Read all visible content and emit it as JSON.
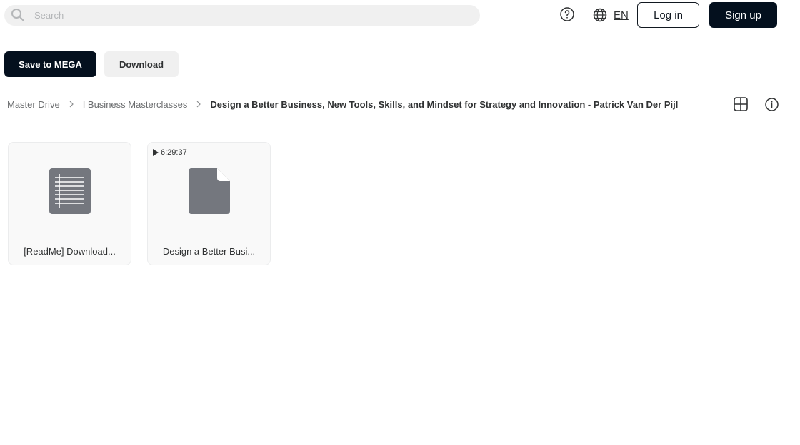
{
  "search": {
    "placeholder": "Search",
    "value": ""
  },
  "header": {
    "language_code": "EN",
    "login_label": "Log in",
    "signup_label": "Sign up"
  },
  "actions": {
    "save_label": "Save to MEGA",
    "download_label": "Download"
  },
  "breadcrumb": {
    "items": [
      "Master Drive",
      "I Business Masterclasses"
    ],
    "current": "Design a Better Business, New Tools, Skills, and Mindset for Strategy and Innovation - Patrick Van Der Pijl"
  },
  "files": [
    {
      "name": "[ReadMe] Download...",
      "type": "text",
      "icon": "text-file-icon"
    },
    {
      "name": "Design a Better Busi...",
      "type": "video",
      "icon": "generic-file-icon",
      "duration": "6:29:37"
    }
  ],
  "colors": {
    "primary_dark": "#04101e",
    "file_icon_gray": "#74777e",
    "muted_bg": "#f0f0f0"
  }
}
